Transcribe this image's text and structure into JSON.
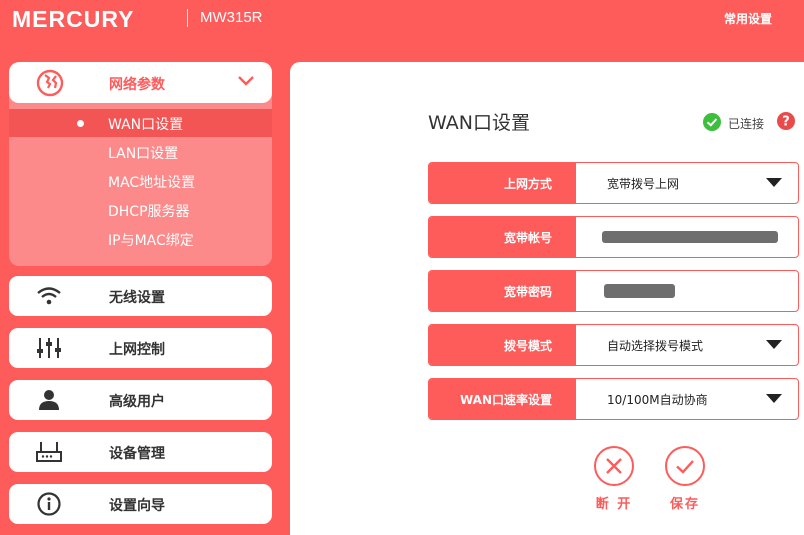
{
  "header": {
    "brand": "MERCURY",
    "model": "MW315R",
    "common_settings": "常用设置"
  },
  "sidebar": {
    "network_group": {
      "label": "网络参数",
      "icon": "globe-icon",
      "items": [
        {
          "label": "WAN口设置",
          "active": true
        },
        {
          "label": "LAN口设置",
          "active": false
        },
        {
          "label": "MAC地址设置",
          "active": false
        },
        {
          "label": "DHCP服务器",
          "active": false
        },
        {
          "label": "IP与MAC绑定",
          "active": false
        }
      ]
    },
    "menu": [
      {
        "label": "无线设置",
        "icon": "wifi-icon"
      },
      {
        "label": "上网控制",
        "icon": "sliders-icon"
      },
      {
        "label": "高级用户",
        "icon": "user-icon"
      },
      {
        "label": "设备管理",
        "icon": "router-icon"
      },
      {
        "label": "设置向导",
        "icon": "info-icon"
      }
    ]
  },
  "main": {
    "title": "WAN口设置",
    "status": "已连接",
    "fields": [
      {
        "label": "上网方式",
        "value": "宽带拨号上网",
        "type": "select"
      },
      {
        "label": "宽带帐号",
        "value": "",
        "type": "redacted"
      },
      {
        "label": "宽带密码",
        "value": "",
        "type": "redacted"
      },
      {
        "label": "拨号模式",
        "value": "自动选择拨号模式",
        "type": "select"
      },
      {
        "label": "WAN口速率设置",
        "value": "10/100M自动协商",
        "type": "select"
      }
    ],
    "buttons": {
      "disconnect": "断 开",
      "save": "保存"
    }
  },
  "colors": {
    "accent": "#fe5b5b",
    "submenu_bg": "#fd8a8a",
    "ok": "#3cbf3c",
    "help": "#e94b4b"
  }
}
